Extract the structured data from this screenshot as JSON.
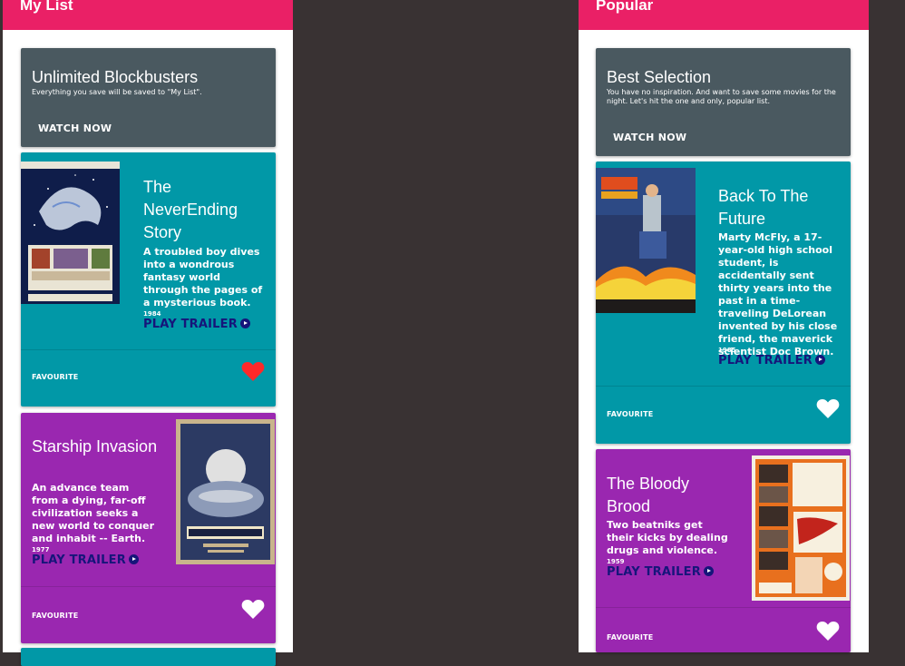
{
  "my_list": {
    "title": "My List",
    "promo": {
      "title": "Unlimited Blockbusters",
      "description": "Everything you save will be saved to \"My List\".",
      "button": "WATCH NOW"
    },
    "movies": [
      {
        "title": "The NeverEnding Story",
        "description": "A troubled boy dives into a wondrous fantasy world through the pages of a mysterious book.",
        "year": "1984",
        "trailer": "PLAY TRAILER",
        "favourite_label": "FAVOURITE",
        "favourited": true,
        "poster_icon": "neverending-story-poster"
      },
      {
        "title": "Starship Invasion",
        "description": "An advance team from a dying, far-off civilization seeks a new world to conquer and inhabit -- Earth.",
        "year": "1977",
        "trailer": "PLAY TRAILER",
        "favourite_label": "FAVOURITE",
        "favourited": false,
        "poster_icon": "starship-invasions-poster"
      }
    ]
  },
  "popular": {
    "title": "Popular",
    "promo": {
      "title": "Best Selection",
      "description": "You have no inspiration. And want to save some movies for the night. Let's hit the one and only, popular list.",
      "button": "WATCH NOW"
    },
    "movies": [
      {
        "title": "Back To The Future",
        "description": "Marty McFly, a 17-year-old high school student, is accidentally sent thirty years into the past in a time-traveling DeLorean invented by his close friend, the maverick scientist Doc Brown.",
        "year": "1985",
        "trailer": "PLAY TRAILER",
        "favourite_label": "FAVOURITE",
        "favourited": false,
        "poster_icon": "back-to-the-future-poster"
      },
      {
        "title": "The Bloody Brood",
        "description": "Two beatniks get their kicks by dealing drugs and violence.",
        "year": "1959",
        "trailer": "PLAY TRAILER",
        "favourite_label": "FAVOURITE",
        "favourited": false,
        "poster_icon": "bloody-brood-poster"
      }
    ]
  },
  "colors": {
    "header": "#ea2066",
    "promo": "#4a5960",
    "teal_card": "#0198a7",
    "purple_card": "#9a27b0",
    "trailer_link": "#16157a",
    "heart_active": "#ff2929",
    "heart_inactive": "#ffffff",
    "background": "#393233"
  }
}
